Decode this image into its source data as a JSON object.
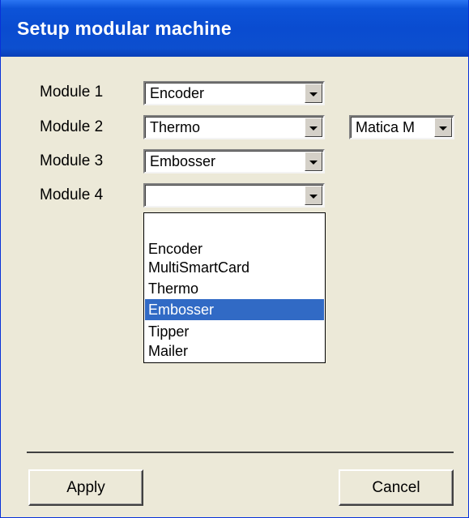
{
  "window": {
    "title": "Setup modular machine"
  },
  "modules": [
    {
      "label": "Module 1",
      "value": "Encoder"
    },
    {
      "label": "Module 2",
      "value": "Thermo"
    },
    {
      "label": "Module 3",
      "value": "Embosser"
    },
    {
      "label": "Module 4",
      "value": ""
    }
  ],
  "machine_combo": {
    "value": "Matica M"
  },
  "dropdown": {
    "options": [
      "",
      "Encoder",
      "MultiSmartCard",
      "Thermo",
      "Embosser",
      "Tipper",
      "Mailer"
    ],
    "selected": "Embosser"
  },
  "buttons": {
    "apply": "Apply",
    "cancel": "Cancel"
  },
  "colors": {
    "title_bar": "#0a4cd0",
    "selection": "#316ac5",
    "dialog_bg": "#ece9d8"
  },
  "icons": {
    "combo_arrow": "chevron-down-icon"
  }
}
